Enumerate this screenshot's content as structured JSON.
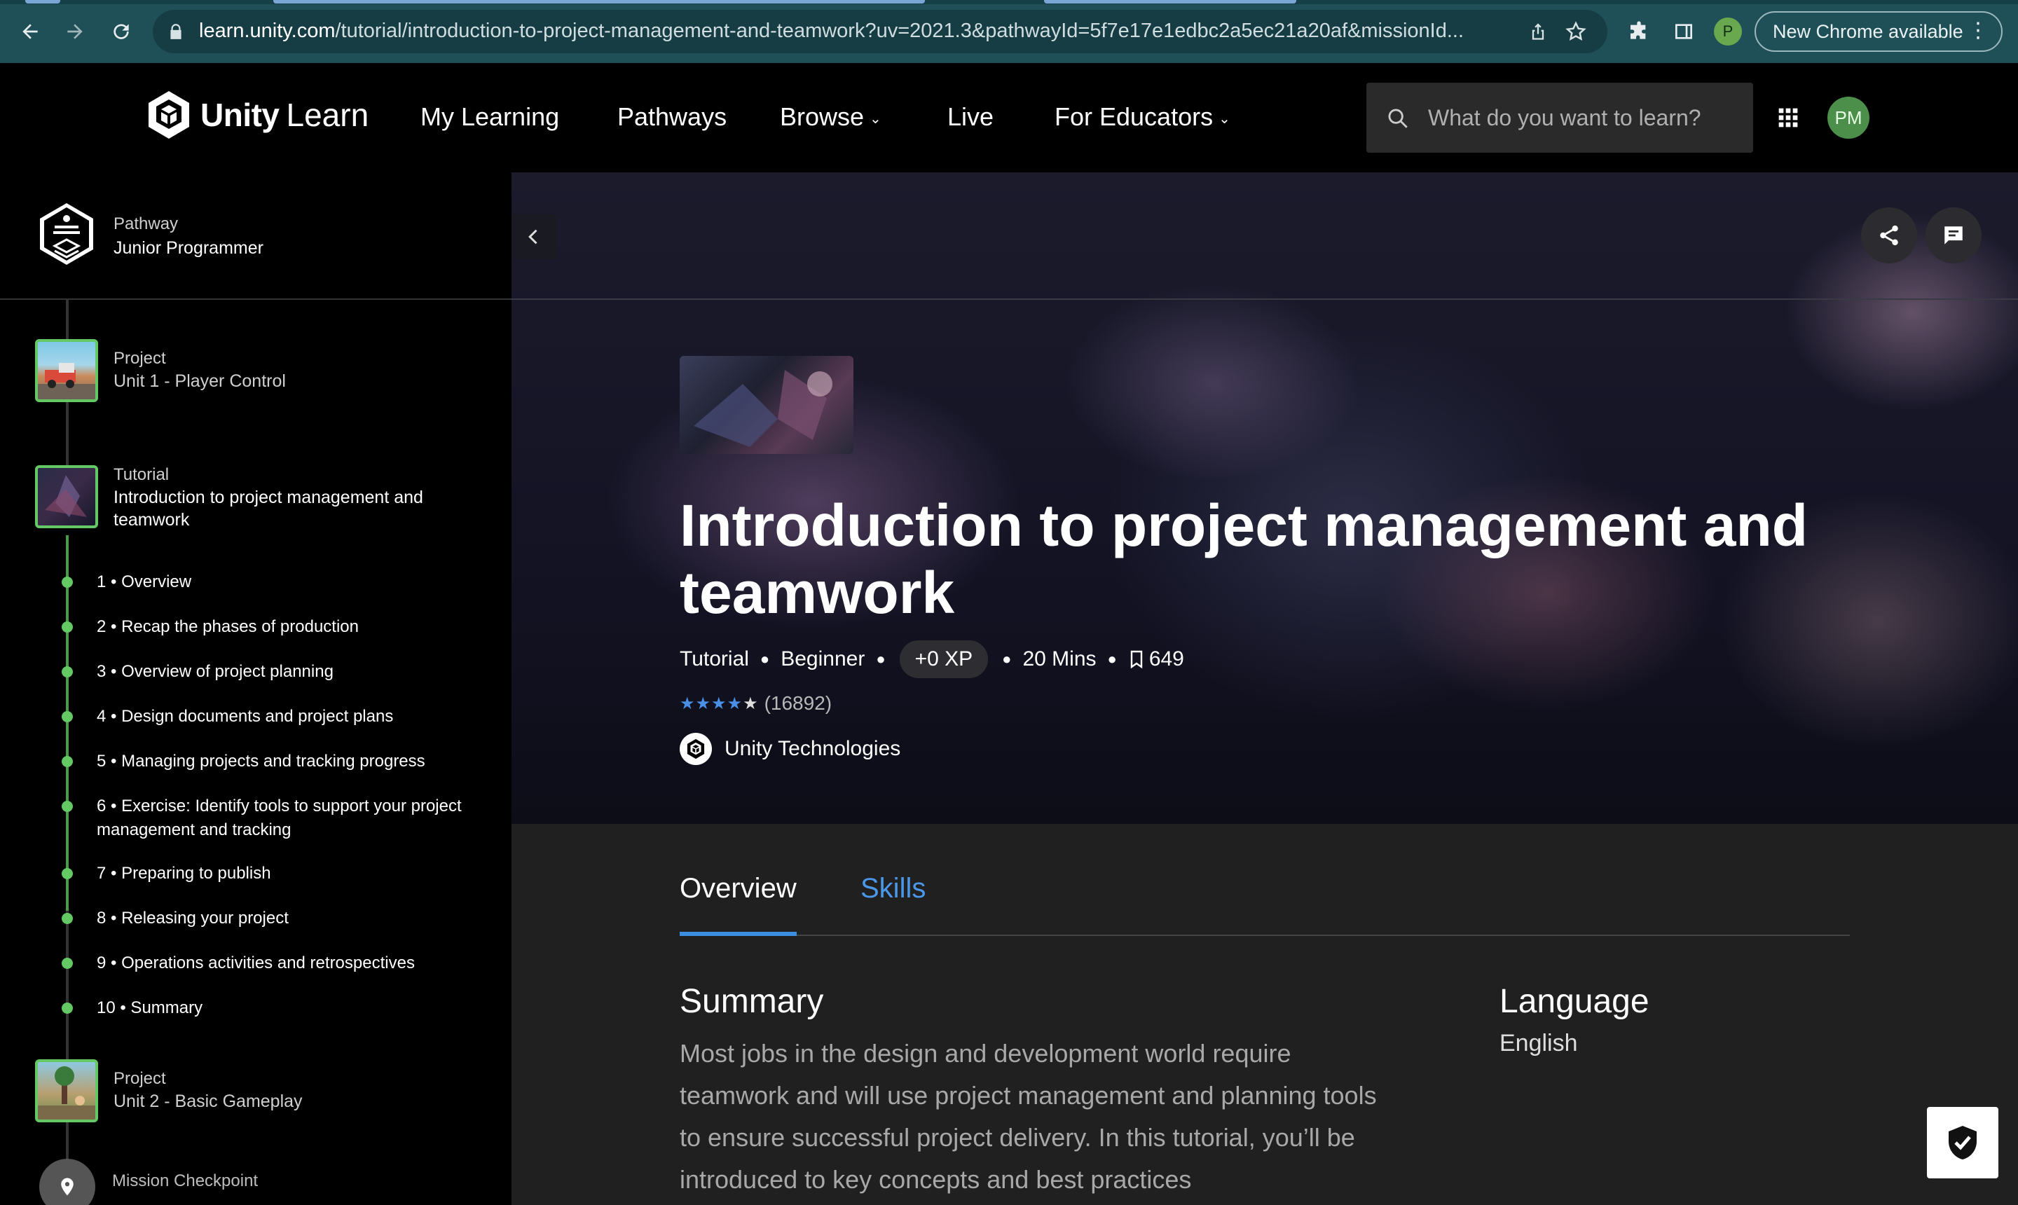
{
  "browser": {
    "url_host": "learn.unity.com",
    "url_path": "/tutorial/introduction-to-project-management-and-teamwork?uv=2021.3&pathwayId=5f7e17e1edbc2a5ec21a20af&missionId...",
    "profile_initial": "P",
    "new_chrome_label": "New Chrome available"
  },
  "header": {
    "logo_unity": "Unity",
    "logo_learn": "Learn",
    "nav": {
      "my_learning": "My Learning",
      "pathways": "Pathways",
      "browse": "Browse",
      "live": "Live",
      "for_educators": "For Educators"
    },
    "search_placeholder": "What do you want to learn?",
    "avatar_initials": "PM"
  },
  "sidebar": {
    "pathway": {
      "type": "Pathway",
      "name": "Junior Programmer"
    },
    "unit1": {
      "type": "Project",
      "name": "Unit 1 - Player Control"
    },
    "tutorial": {
      "type": "Tutorial",
      "name": "Introduction to project management and teamwork"
    },
    "steps": [
      "1 • Overview",
      "2 • Recap the phases of production",
      "3 • Overview of project planning",
      "4 • Design documents and project plans",
      "5 • Managing projects and tracking progress",
      "6 • Exercise: Identify tools to support your project management and tracking",
      "7 • Preparing to publish",
      "8 • Releasing your project",
      "9 • Operations activities and retrospectives",
      "10 • Summary"
    ],
    "unit2": {
      "type": "Project",
      "name": "Unit 2 - Basic Gameplay"
    },
    "checkpoint": "Mission Checkpoint"
  },
  "hero": {
    "title": "Introduction to project management and teamwork",
    "meta": {
      "type": "Tutorial",
      "level": "Beginner",
      "xp": "+0 XP",
      "duration": "20 Mins",
      "bookmarks": "649"
    },
    "rating_count": "(16892)",
    "rating_value": 4,
    "author": "Unity Technologies"
  },
  "content": {
    "tabs": {
      "overview": "Overview",
      "skills": "Skills"
    },
    "summary_heading": "Summary",
    "summary_text": "Most jobs in the design and development world require teamwork and will use project management and planning tools to ensure successful project delivery. In this tutorial, you’ll be introduced to key concepts and best practices",
    "language_heading": "Language",
    "language_value": "English"
  },
  "colors": {
    "accent_green": "#64c864",
    "link_blue": "#4b97ea",
    "star_blue": "#4a8fe6",
    "chrome_bar": "#1f4f57"
  },
  "icons": [
    "back-icon",
    "forward-icon",
    "reload-icon",
    "lock-icon",
    "share-page-icon",
    "star-icon",
    "extension-icon",
    "sidepanel-icon",
    "search-icon",
    "apps-grid-icon",
    "chevron-left-icon",
    "share-icon",
    "comment-icon",
    "bookmark-icon",
    "location-pin-icon",
    "shield-check-icon"
  ]
}
